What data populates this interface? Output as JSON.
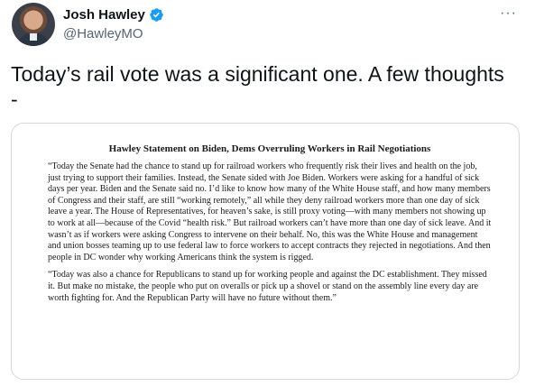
{
  "author": {
    "name": "Josh Hawley",
    "handle": "@HawleyMO",
    "verified_color": "#1d9bf0"
  },
  "more_label": "···",
  "tweet": {
    "text": "Today’s rail vote was a significant one. A few thoughts\n-"
  },
  "statement": {
    "title": "Hawley Statement on Biden, Dems Overruling Workers in Rail Negotiations",
    "paragraph_1": "“Today the Senate had the chance to stand up for railroad workers who frequently risk their lives and health on the job, just trying to support their families. Instead, the Senate sided with Joe Biden. Workers were asking for a handful of sick days per year. Biden and the Senate said no. I’d like to know how many of the White House staff, and how many members of Congress and their staff, are still “working remotely,” all while they deny railroad workers more than one day of sick leave a year. The House of Representatives, for heaven’s sake, is still proxy voting—with many members not showing up to work at all—because of the Covid “health risk.” But railroad workers can’t have more than one day of sick leave. And it wasn’t as if workers were asking Congress to intervene on their behalf. No, this was the White House and management and union bosses teaming up to use federal law to force workers to accept contracts they rejected in negotiations. And then people in DC wonder why working Americans think the system is rigged.",
    "paragraph_2": "“Today was also a chance for Republicans to stand up for working people and against the DC establishment. They missed it. But make no mistake, the people who put on overalls or pick up a shovel or stand on the assembly line every day are worth fighting for. And the Republican Party will have no future without them.”"
  }
}
